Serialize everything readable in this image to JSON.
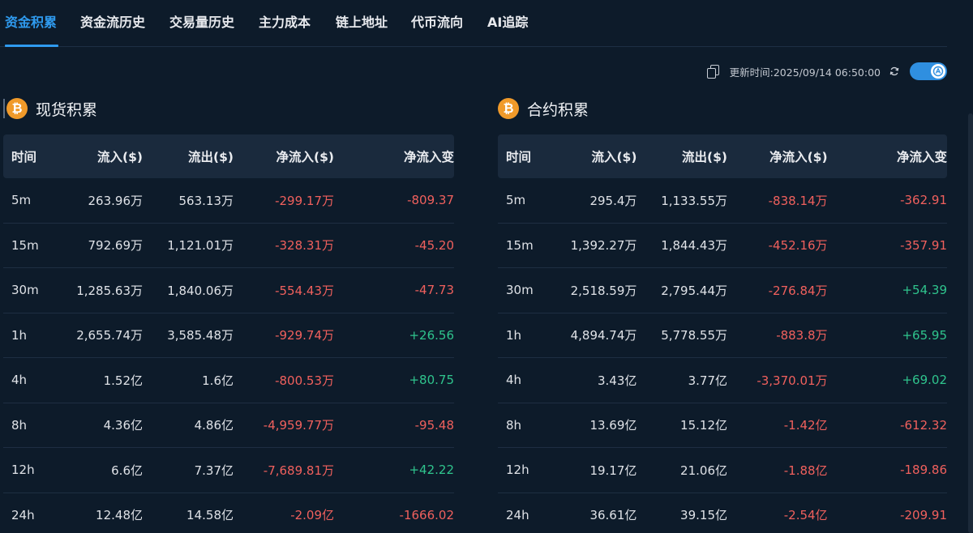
{
  "tabs": [
    {
      "label": "资金积累",
      "active": true
    },
    {
      "label": "资金流历史",
      "active": false
    },
    {
      "label": "交易量历史",
      "active": false
    },
    {
      "label": "主力成本",
      "active": false
    },
    {
      "label": "链上地址",
      "active": false
    },
    {
      "label": "代币流向",
      "active": false
    },
    {
      "label": "AI追踪",
      "active": false
    }
  ],
  "toolbar": {
    "update_time": "更新时间:2025/09/14 06:50:00",
    "toggle_on": true
  },
  "colors": {
    "accent": "#2f9bef",
    "negative": "#f0605d",
    "positive": "#2fc48d",
    "btc": "#f09a2a",
    "background": "#0d1b2a"
  },
  "headers": {
    "time": "时间",
    "inflow": "流入($)",
    "outflow": "流出($)",
    "net": "净流入($)",
    "change": "净流入变"
  },
  "spot": {
    "title": "现货积累",
    "coin_glyph": "₿",
    "rows": [
      {
        "time": "5m",
        "inflow": "263.96万",
        "outflow": "563.13万",
        "net": "-299.17万",
        "change": "-809.37"
      },
      {
        "time": "15m",
        "inflow": "792.69万",
        "outflow": "1,121.01万",
        "net": "-328.31万",
        "change": "-45.20"
      },
      {
        "time": "30m",
        "inflow": "1,285.63万",
        "outflow": "1,840.06万",
        "net": "-554.43万",
        "change": "-47.73"
      },
      {
        "time": "1h",
        "inflow": "2,655.74万",
        "outflow": "3,585.48万",
        "net": "-929.74万",
        "change": "+26.56"
      },
      {
        "time": "4h",
        "inflow": "1.52亿",
        "outflow": "1.6亿",
        "net": "-800.53万",
        "change": "+80.75"
      },
      {
        "time": "8h",
        "inflow": "4.36亿",
        "outflow": "4.86亿",
        "net": "-4,959.77万",
        "change": "-95.48"
      },
      {
        "time": "12h",
        "inflow": "6.6亿",
        "outflow": "7.37亿",
        "net": "-7,689.81万",
        "change": "+42.22"
      },
      {
        "time": "24h",
        "inflow": "12.48亿",
        "outflow": "14.58亿",
        "net": "-2.09亿",
        "change": "-1666.02"
      }
    ]
  },
  "futures": {
    "title": "合约积累",
    "coin_glyph": "₿",
    "rows": [
      {
        "time": "5m",
        "inflow": "295.4万",
        "outflow": "1,133.55万",
        "net": "-838.14万",
        "change": "-362.91"
      },
      {
        "time": "15m",
        "inflow": "1,392.27万",
        "outflow": "1,844.43万",
        "net": "-452.16万",
        "change": "-357.91"
      },
      {
        "time": "30m",
        "inflow": "2,518.59万",
        "outflow": "2,795.44万",
        "net": "-276.84万",
        "change": "+54.39"
      },
      {
        "time": "1h",
        "inflow": "4,894.74万",
        "outflow": "5,778.55万",
        "net": "-883.8万",
        "change": "+65.95"
      },
      {
        "time": "4h",
        "inflow": "3.43亿",
        "outflow": "3.77亿",
        "net": "-3,370.01万",
        "change": "+69.02"
      },
      {
        "time": "8h",
        "inflow": "13.69亿",
        "outflow": "15.12亿",
        "net": "-1.42亿",
        "change": "-612.32"
      },
      {
        "time": "12h",
        "inflow": "19.17亿",
        "outflow": "21.06亿",
        "net": "-1.88亿",
        "change": "-189.86"
      },
      {
        "time": "24h",
        "inflow": "36.61亿",
        "outflow": "39.15亿",
        "net": "-2.54亿",
        "change": "-209.91"
      }
    ]
  }
}
